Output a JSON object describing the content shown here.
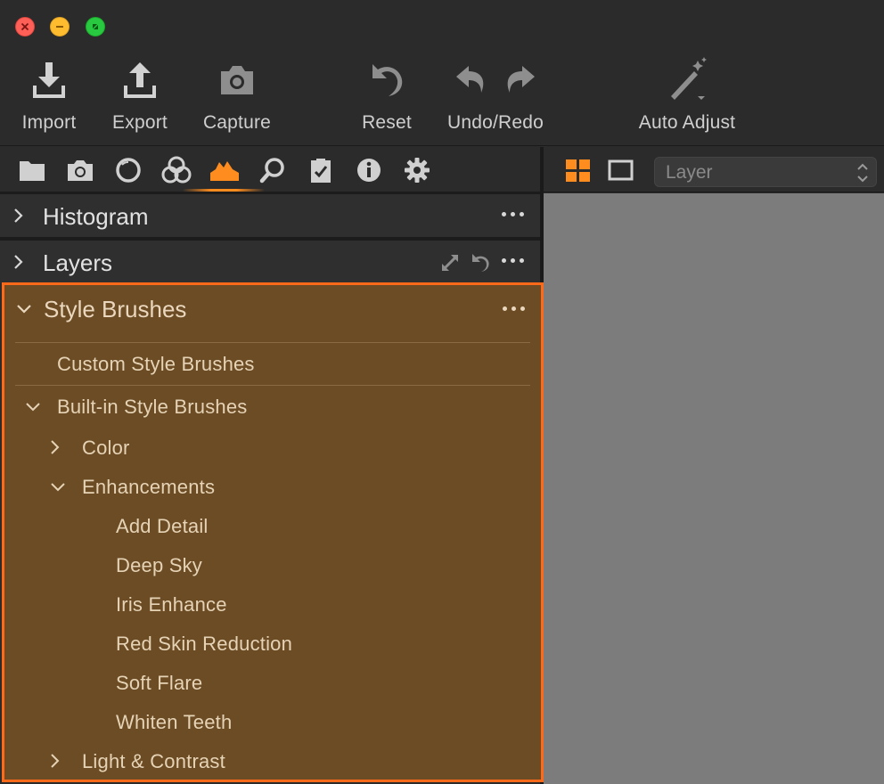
{
  "window": {
    "buttons": [
      "close",
      "minimize",
      "maximize"
    ]
  },
  "toolbar": {
    "items": [
      {
        "label": "Import",
        "icon": "import-icon"
      },
      {
        "label": "Export",
        "icon": "export-icon"
      },
      {
        "label": "Capture",
        "icon": "camera-icon"
      },
      {
        "label": "Reset",
        "icon": "reset-icon"
      },
      {
        "label": "Undo/Redo",
        "icon": "undo-redo-icon"
      },
      {
        "label": "Auto Adjust",
        "icon": "magic-wand-icon"
      }
    ]
  },
  "tool_tabs": [
    {
      "icon": "folder-icon"
    },
    {
      "icon": "camera-icon"
    },
    {
      "icon": "lens-icon"
    },
    {
      "icon": "color-icon"
    },
    {
      "icon": "exposure-icon",
      "active": true
    },
    {
      "icon": "details-icon"
    },
    {
      "icon": "clipboard-icon"
    },
    {
      "icon": "info-icon"
    },
    {
      "icon": "gear-icon"
    }
  ],
  "viewer_header": {
    "layer_select_value": "Layer"
  },
  "panels": {
    "histogram": {
      "title": "Histogram"
    },
    "layers": {
      "title": "Layers"
    },
    "style_brushes": {
      "title": "Style Brushes",
      "custom": "Custom Style Brushes",
      "builtin": "Built-in Style Brushes",
      "color": "Color",
      "enhancements": "Enhancements",
      "enhancement_items": [
        "Add Detail",
        "Deep Sky",
        "Iris Enhance",
        "Red Skin Reduction",
        "Soft Flare",
        "Whiten Teeth"
      ],
      "light_contrast": "Light & Contrast"
    }
  },
  "colors": {
    "accent": "#ff8c1e",
    "panel_highlight": "#6b4c25",
    "panel_border": "#ff6a1a"
  }
}
